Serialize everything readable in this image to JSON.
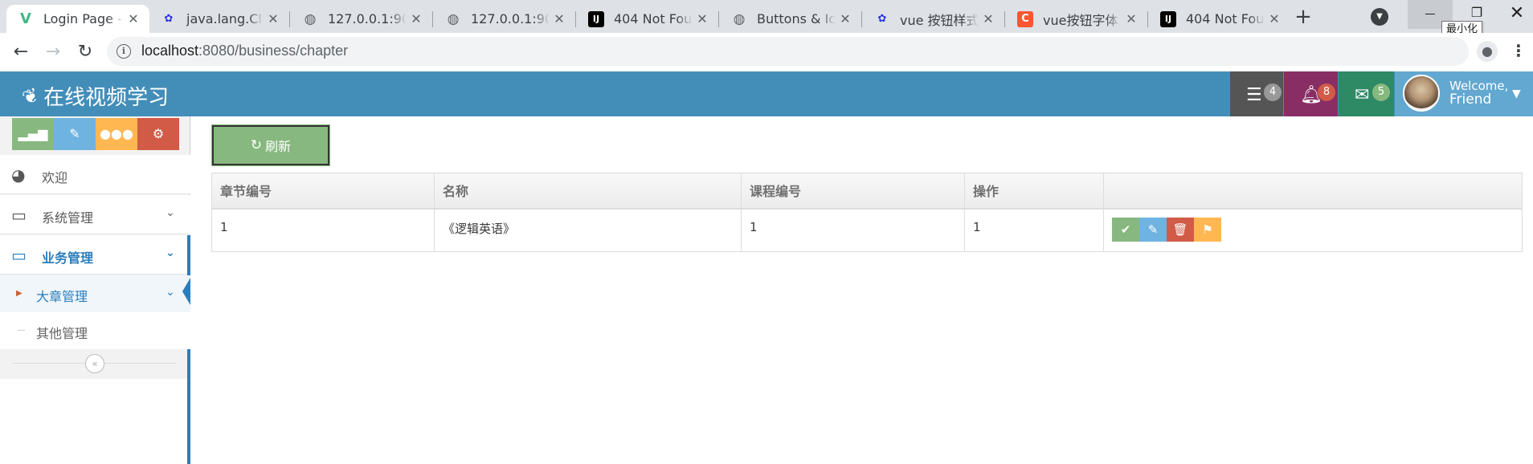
{
  "browser": {
    "tabs": [
      {
        "title": "Login Page - ",
        "favicon": "vue-icon",
        "active": true
      },
      {
        "title": "java.lang.Clas",
        "favicon": "baidu-icon"
      },
      {
        "title": "127.0.0.1:900",
        "favicon": "globe-icon"
      },
      {
        "title": "127.0.0.1:900",
        "favicon": "globe-icon"
      },
      {
        "title": "404 Not Fou",
        "favicon": "intellij-icon"
      },
      {
        "title": "Buttons & Ico",
        "favicon": "globe-icon"
      },
      {
        "title": "vue 按钮样式",
        "favicon": "baidu-icon"
      },
      {
        "title": "vue按钮字体",
        "favicon": "csdn-icon"
      },
      {
        "title": "404 Not Fou",
        "favicon": "intellij-icon"
      }
    ],
    "new_tab": "+",
    "tooltip": "最小化",
    "url_host": "localhost",
    "url_path": ":8080/business/chapter"
  },
  "header": {
    "brand": "在线视频学习",
    "tasks_count": "4",
    "notifications_count": "8",
    "messages_count": "5",
    "welcome_line1": "Welcome,",
    "welcome_line2": "Friend",
    "colors": {
      "bar": "#438eb9",
      "tasks": "#555555",
      "notifications": "#892e65",
      "messages": "#2e8965",
      "user": "#62a8d1"
    }
  },
  "sidebar": {
    "shortcut_colors": [
      "#87b87f",
      "#6fb3e0",
      "#ffb752",
      "#d15b47"
    ],
    "items": [
      {
        "label": "欢迎",
        "icon": "dashboard-icon"
      },
      {
        "label": "系统管理",
        "icon": "desktop-icon"
      },
      {
        "label": "业务管理",
        "icon": "desktop-icon"
      }
    ],
    "subitems": [
      {
        "label": "大章管理"
      },
      {
        "label": "其他管理"
      }
    ]
  },
  "main": {
    "refresh_label": "刷新",
    "table": {
      "headers": [
        "章节编号",
        "名称",
        "课程编号",
        "操作",
        ""
      ],
      "rows": [
        {
          "id": "1",
          "name": "《逻辑英语》",
          "course_id": "1",
          "op": "1"
        }
      ]
    },
    "action_colors": {
      "check": "#87b87f",
      "edit": "#6fb3e0",
      "delete": "#d15b47",
      "flag": "#ffb752"
    }
  }
}
